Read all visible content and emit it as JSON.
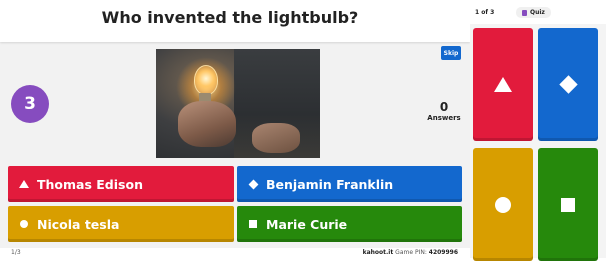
{
  "host": {
    "question": "Who invented the lightbulb?",
    "timer": "3",
    "skip_label": "Skip",
    "answers_count": "0",
    "answers_label": "Answers",
    "answers": [
      {
        "text": "Thomas Edison",
        "color": "#e21b3c",
        "shape": "triangle-icon"
      },
      {
        "text": "Benjamin Franklin",
        "color": "#1368ce",
        "shape": "diamond-icon"
      },
      {
        "text": "Nicola tesla",
        "color": "#d89e00",
        "shape": "circle-icon"
      },
      {
        "text": "Marie Curie",
        "color": "#26890c",
        "shape": "square-icon"
      }
    ],
    "footer": {
      "progress": "1/3",
      "site": "kahoot.it",
      "game_pin_label": "Game PIN:",
      "game_pin": "4209996"
    }
  },
  "player": {
    "progress": "1 of 3",
    "quiz_label": "Quiz",
    "buttons": [
      {
        "shape": "triangle-icon",
        "color": "#e21b3c"
      },
      {
        "shape": "diamond-icon",
        "color": "#1368ce"
      },
      {
        "shape": "circle-icon",
        "color": "#d89e00"
      },
      {
        "shape": "square-icon",
        "color": "#26890c"
      }
    ]
  }
}
